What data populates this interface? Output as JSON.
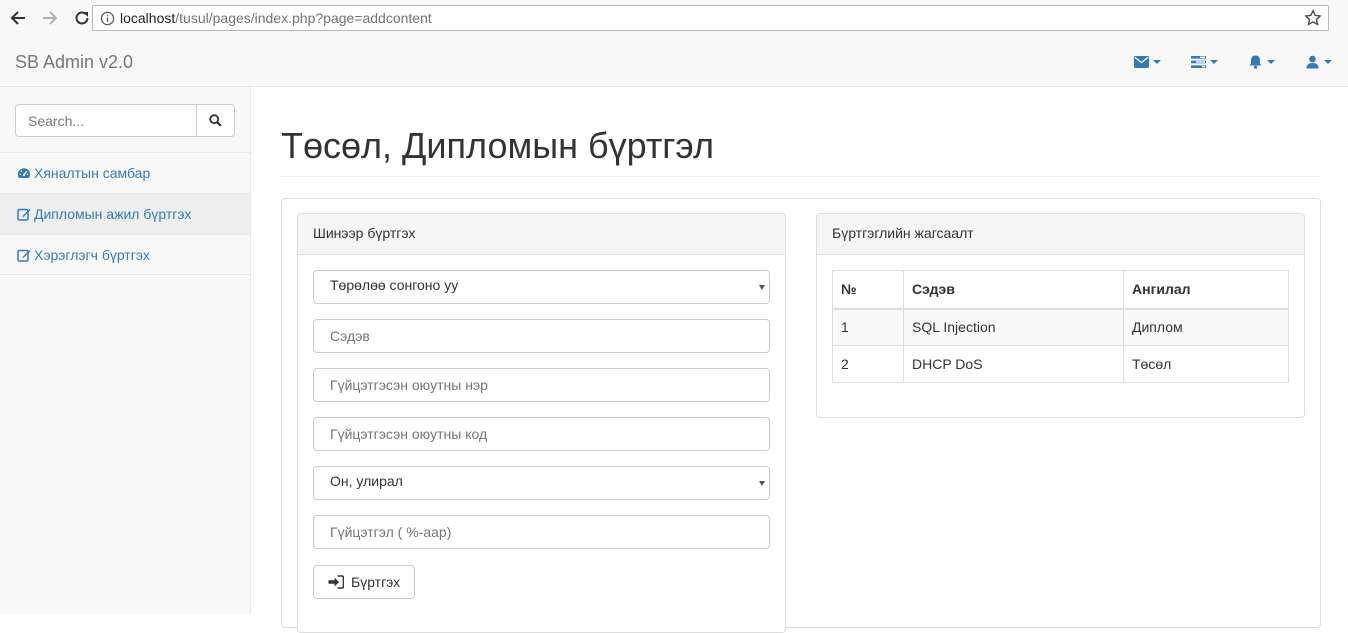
{
  "browser": {
    "url_host": "localhost",
    "url_path": "/tusul/pages/index.php?page=addcontent"
  },
  "navbar": {
    "brand": "SB Admin v2.0",
    "icons": [
      "envelope-icon",
      "tasks-icon",
      "bell-icon",
      "user-icon"
    ],
    "accent_color": "#337ab7"
  },
  "sidebar": {
    "search_placeholder": "Search...",
    "items": [
      {
        "label": "Хяналтын самбар",
        "icon": "dashboard-icon"
      },
      {
        "label": "Дипломын ажил бүртгэх",
        "icon": "edit-icon"
      },
      {
        "label": "Хэрэглэгч бүртгэх",
        "icon": "edit-icon"
      }
    ]
  },
  "main": {
    "title": "Төсөл, Дипломын бүртгэл",
    "register_panel": {
      "heading": "Шинээр бүртгэх",
      "type_select": "Төрөлөө сонгоно уу",
      "topic_placeholder": "Сэдэв",
      "student_name_placeholder": "Гүйцэтгэсэн оюутны нэр",
      "student_code_placeholder": "Гүйцэтгэсэн оюутны код",
      "term_select": "Он, улирал",
      "progress_placeholder": "Гүйцэтгэл ( %-аар)",
      "submit_label": "Бүртгэх"
    },
    "list_panel": {
      "heading": "Бүртгэглийн жагсаалт",
      "columns": [
        "№",
        "Сэдэв",
        "Ангилал"
      ],
      "rows": [
        [
          "1",
          "SQL Injection",
          "Диплом"
        ],
        [
          "2",
          "DHCP DoS",
          "Төсөл"
        ]
      ]
    }
  }
}
